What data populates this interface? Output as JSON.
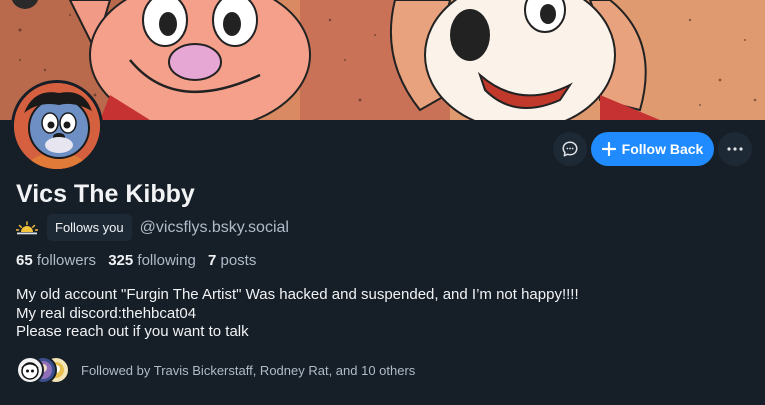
{
  "profile": {
    "display_name": "Vics The Kibby",
    "handle": "@vicsflys.bsky.social",
    "follows_you_label": "Follows you",
    "followers_count": "65",
    "followers_label": "followers",
    "following_count": "325",
    "following_label": "following",
    "posts_count": "7",
    "posts_label": "posts",
    "bio": [
      "My old account \"Furgin The Artist\" Was hacked and suspended, and I’m not happy!!!!",
      "My real discord:thehbcat04",
      "Please reach out if you want to talk"
    ],
    "followed_by_text": "Followed by Travis Bickerstaff, Rodney Rat, and 10 others"
  },
  "actions": {
    "follow_back_label": "Follow Back",
    "message_icon": "chat-bubble-icon",
    "more_icon": "ellipsis-icon"
  },
  "colors": {
    "background": "#161e27",
    "accent": "#208bfe",
    "secondary_text": "#aebbc9",
    "button_bg": "#1e2936"
  }
}
